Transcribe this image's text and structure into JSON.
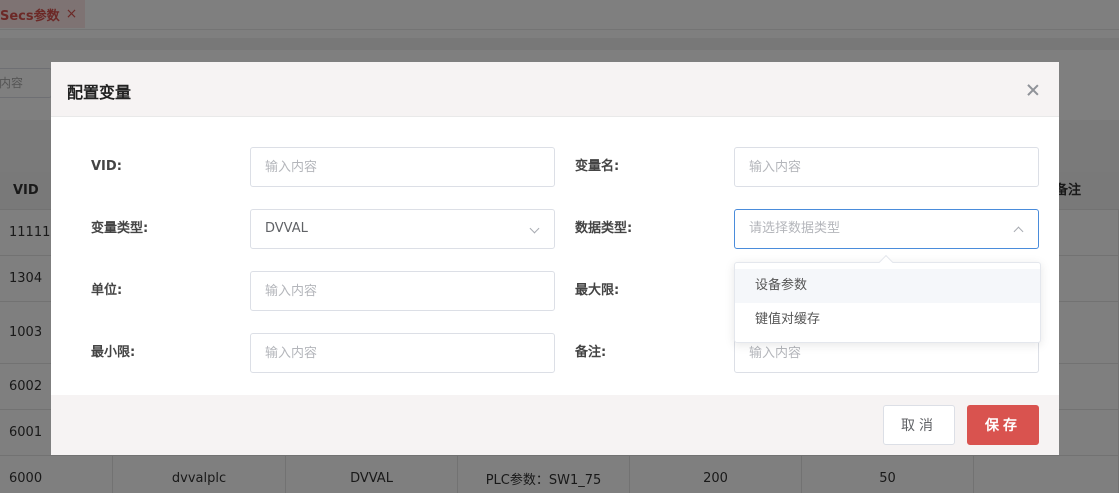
{
  "background": {
    "tab": {
      "label": "Secs参数",
      "close": "×"
    },
    "search_placeholder": "内容",
    "table": {
      "headers": [
        "VID",
        "备注"
      ],
      "rows": [
        [
          "11111",
          "",
          "",
          "",
          "",
          ""
        ],
        [
          "1304",
          "",
          "",
          "",
          "",
          ""
        ],
        [
          "1003",
          "",
          "",
          "",
          "",
          ""
        ],
        [
          "6002",
          "",
          "",
          "",
          "",
          ""
        ],
        [
          "6001",
          "",
          "",
          "",
          "",
          ""
        ],
        [
          "6000",
          "dvvalplc",
          "DVVAL",
          "PLC参数：SW1_75",
          "200",
          "50"
        ]
      ]
    }
  },
  "dialog": {
    "title": "配置变量",
    "fields": {
      "vid": {
        "label": "VID:",
        "placeholder": "输入内容"
      },
      "var_name": {
        "label": "变量名:",
        "placeholder": "输入内容"
      },
      "var_type": {
        "label": "变量类型:",
        "value": "DVVAL"
      },
      "data_type": {
        "label": "数据类型:",
        "placeholder": "请选择数据类型"
      },
      "unit": {
        "label": "单位:",
        "placeholder": "输入内容"
      },
      "max": {
        "label": "最大限:"
      },
      "min": {
        "label": "最小限:",
        "placeholder": "输入内容"
      },
      "remark": {
        "label": "备注:",
        "placeholder": "输入内容"
      }
    },
    "dropdown_options": [
      "设备参数",
      "键值对缓存"
    ],
    "buttons": {
      "cancel": "取消",
      "save": "保存"
    }
  },
  "colors": {
    "accent": "#d9534f",
    "focus_border": "#4a8cdb",
    "header_bg": "#f6f3f3"
  }
}
